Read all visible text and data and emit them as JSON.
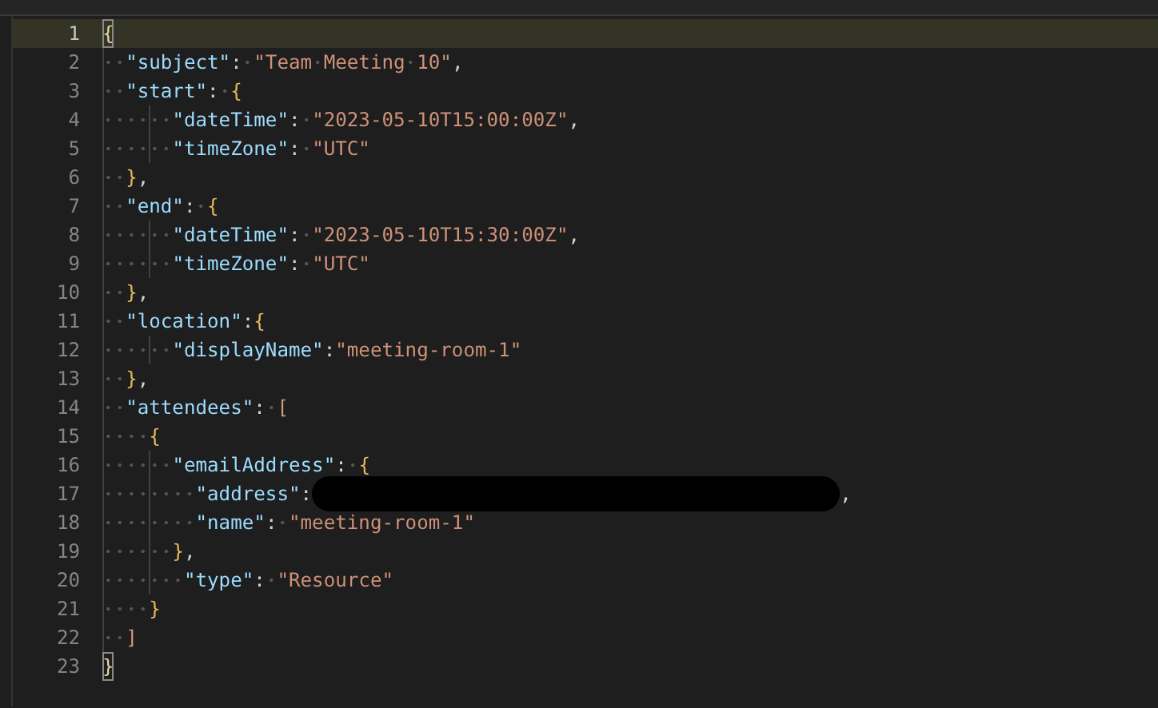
{
  "lines": [
    {
      "number": "1",
      "current": true,
      "tokens": [
        {
          "kind": "bracket",
          "text": "{",
          "color": "#e6d9a2",
          "matched": true
        }
      ]
    },
    {
      "number": "2",
      "current": false,
      "tokens": [
        {
          "kind": "key",
          "text": "  \"subject\""
        },
        {
          "kind": "punct",
          "text": ": "
        },
        {
          "kind": "string",
          "text": "\"Team Meeting 10\""
        },
        {
          "kind": "punct",
          "text": ","
        }
      ]
    },
    {
      "number": "3",
      "current": false,
      "tokens": [
        {
          "kind": "key",
          "text": "  \"start\""
        },
        {
          "kind": "punct",
          "text": ": "
        },
        {
          "kind": "bracket",
          "text": "{",
          "color": "#e5b95c",
          "matched": false
        }
      ]
    },
    {
      "number": "4",
      "current": false,
      "tokens": [
        {
          "kind": "key",
          "text": "      \"dateTime\""
        },
        {
          "kind": "punct",
          "text": ": "
        },
        {
          "kind": "string",
          "text": "\"2023-05-10T15:00:00Z\""
        },
        {
          "kind": "punct",
          "text": ","
        }
      ]
    },
    {
      "number": "5",
      "current": false,
      "tokens": [
        {
          "kind": "key",
          "text": "      \"timeZone\""
        },
        {
          "kind": "punct",
          "text": ": "
        },
        {
          "kind": "string",
          "text": "\"UTC\""
        }
      ]
    },
    {
      "number": "6",
      "current": false,
      "tokens": [
        {
          "kind": "bracket",
          "text": "  }",
          "color": "#e5b95c",
          "matched": false
        },
        {
          "kind": "punct",
          "text": ","
        }
      ]
    },
    {
      "number": "7",
      "current": false,
      "tokens": [
        {
          "kind": "key",
          "text": "  \"end\""
        },
        {
          "kind": "punct",
          "text": ": "
        },
        {
          "kind": "bracket",
          "text": "{",
          "color": "#e5b95c",
          "matched": false
        }
      ]
    },
    {
      "number": "8",
      "current": false,
      "tokens": [
        {
          "kind": "key",
          "text": "      \"dateTime\""
        },
        {
          "kind": "punct",
          "text": ": "
        },
        {
          "kind": "string",
          "text": "\"2023-05-10T15:30:00Z\""
        },
        {
          "kind": "punct",
          "text": ","
        }
      ]
    },
    {
      "number": "9",
      "current": false,
      "tokens": [
        {
          "kind": "key",
          "text": "      \"timeZone\""
        },
        {
          "kind": "punct",
          "text": ": "
        },
        {
          "kind": "string",
          "text": "\"UTC\""
        }
      ]
    },
    {
      "number": "10",
      "current": false,
      "tokens": [
        {
          "kind": "bracket",
          "text": "  }",
          "color": "#e5b95c",
          "matched": false
        },
        {
          "kind": "punct",
          "text": ","
        }
      ]
    },
    {
      "number": "11",
      "current": false,
      "tokens": [
        {
          "kind": "key",
          "text": "  \"location\""
        },
        {
          "kind": "punct",
          "text": ":"
        },
        {
          "kind": "bracket",
          "text": "{",
          "color": "#e5b95c",
          "matched": false
        }
      ]
    },
    {
      "number": "12",
      "current": false,
      "tokens": [
        {
          "kind": "key",
          "text": "      \"displayName\""
        },
        {
          "kind": "punct",
          "text": ":"
        },
        {
          "kind": "string",
          "text": "\"meeting-room-1\""
        }
      ]
    },
    {
      "number": "13",
      "current": false,
      "tokens": [
        {
          "kind": "bracket",
          "text": "  }",
          "color": "#e5b95c",
          "matched": false
        },
        {
          "kind": "punct",
          "text": ","
        }
      ]
    },
    {
      "number": "14",
      "current": false,
      "tokens": [
        {
          "kind": "key",
          "text": "  \"attendees\""
        },
        {
          "kind": "punct",
          "text": ": "
        },
        {
          "kind": "bracket",
          "text": "[",
          "color": "#d49a7a",
          "matched": false
        }
      ]
    },
    {
      "number": "15",
      "current": false,
      "tokens": [
        {
          "kind": "bracket",
          "text": "    {",
          "color": "#e5b95c",
          "matched": false
        }
      ]
    },
    {
      "number": "16",
      "current": false,
      "tokens": [
        {
          "kind": "key",
          "text": "      \"emailAddress\""
        },
        {
          "kind": "punct",
          "text": ": "
        },
        {
          "kind": "bracket",
          "text": "{",
          "color": "#e5b95c",
          "matched": false
        }
      ]
    },
    {
      "number": "17",
      "current": false,
      "tokens": [
        {
          "kind": "key",
          "text": "        \"address\""
        },
        {
          "kind": "punct",
          "text": ":"
        },
        {
          "kind": "redacted"
        },
        {
          "kind": "punct",
          "text": ","
        }
      ]
    },
    {
      "number": "18",
      "current": false,
      "tokens": [
        {
          "kind": "key",
          "text": "        \"name\""
        },
        {
          "kind": "punct",
          "text": ": "
        },
        {
          "kind": "string",
          "text": "\"meeting-room-1\""
        }
      ]
    },
    {
      "number": "19",
      "current": false,
      "tokens": [
        {
          "kind": "bracket",
          "text": "      }",
          "color": "#e5b95c",
          "matched": false
        },
        {
          "kind": "punct",
          "text": ","
        }
      ]
    },
    {
      "number": "20",
      "current": false,
      "tokens": [
        {
          "kind": "key",
          "text": "       \"type\""
        },
        {
          "kind": "punct",
          "text": ": "
        },
        {
          "kind": "string",
          "text": "\"Resource\""
        }
      ]
    },
    {
      "number": "21",
      "current": false,
      "tokens": [
        {
          "kind": "bracket",
          "text": "    }",
          "color": "#e5b95c",
          "matched": false
        }
      ]
    },
    {
      "number": "22",
      "current": false,
      "tokens": [
        {
          "kind": "bracket",
          "text": "  ]",
          "color": "#d49a7a",
          "matched": false
        }
      ]
    },
    {
      "number": "23",
      "current": false,
      "tokens": [
        {
          "kind": "bracket",
          "text": "}",
          "color": "#e6d9a2",
          "matched": true
        }
      ]
    }
  ]
}
